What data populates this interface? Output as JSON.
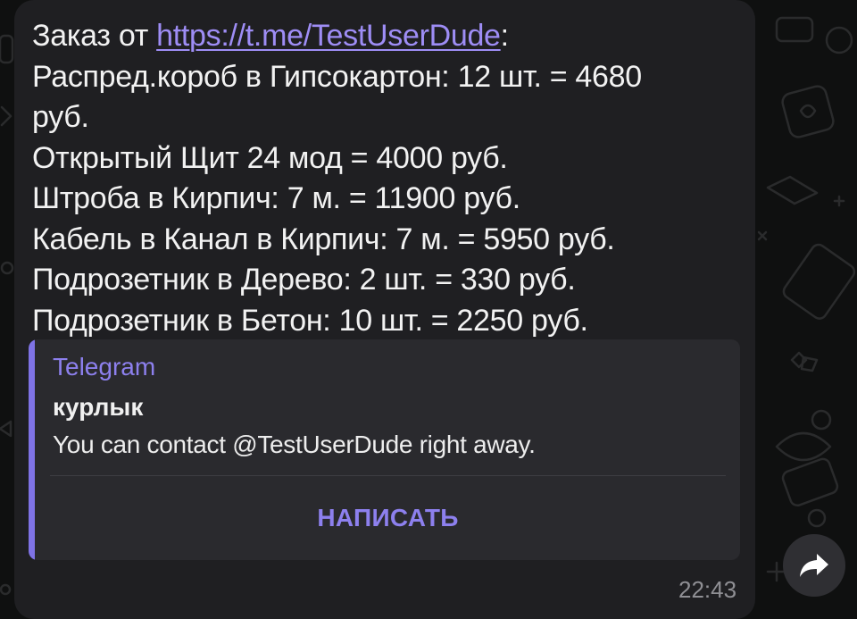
{
  "message": {
    "intro_label": "Заказ от",
    "link_text": "https://t.me/TestUserDude",
    "intro_suffix": ":",
    "lines": [
      "Распред.короб в Гипсокартон: 12 шт. = 4680",
      "руб.",
      "Открытый Щит 24 мод = 4000 руб.",
      "Штроба в Кирпич: 7 м. = 11900 руб.",
      "Кабель в Канал в Кирпич: 7 м. = 5950 руб.",
      "Подрозетник в Дерево: 2 шт. = 330 руб.",
      "Подрозетник в Бетон: 10 шт. = 2250 руб."
    ],
    "time": "22:43"
  },
  "preview": {
    "site_name": "Telegram",
    "title": "курлык",
    "description": "You can contact @TestUserDude right away.",
    "button_label": "НАПИСАТЬ"
  },
  "icons": {
    "share": "share-arrow-icon"
  },
  "colors": {
    "bubble": "#1f1f22",
    "link": "#9e8df5",
    "accent_bar": "#7f73e6",
    "preview_bg": "#2a2a2e",
    "time": "#8f8f94"
  }
}
